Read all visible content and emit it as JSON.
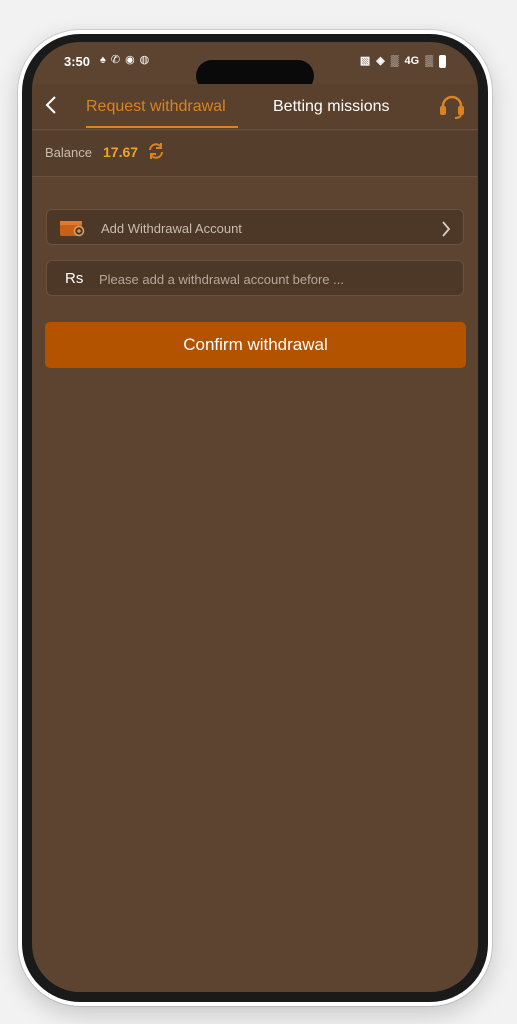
{
  "status_bar": {
    "time": "3:50",
    "network": "4G"
  },
  "header": {
    "tabs": [
      {
        "label": "Request withdrawal",
        "active": true
      },
      {
        "label": "Betting missions",
        "active": false
      }
    ]
  },
  "balance": {
    "label": "Balance",
    "value": "17.67"
  },
  "withdrawal_account": {
    "label": "Add Withdrawal Account"
  },
  "amount": {
    "currency": "Rs",
    "placeholder": "Please add a withdrawal account before ..."
  },
  "confirm_button": {
    "label": "Confirm withdrawal"
  },
  "colors": {
    "background": "#5c4430",
    "accent": "#d98324",
    "button": "#b35300",
    "balance": "#f0a32a"
  },
  "icons": [
    "back-icon",
    "headset-icon",
    "refresh-icon",
    "wallet-icon",
    "chevron-right-icon"
  ]
}
